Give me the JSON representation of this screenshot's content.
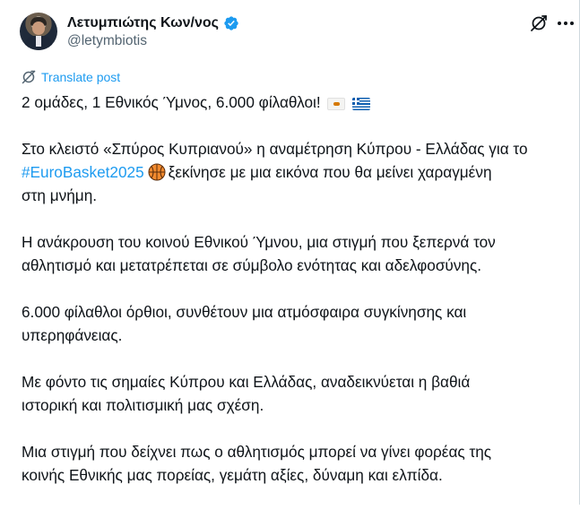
{
  "author": {
    "display_name": "Λετυμπιώτης Κων/νος",
    "handle": "@letymbiotis",
    "verified": true
  },
  "actions": {
    "grok_icon": "grok-icon",
    "more_icon": "more-icon"
  },
  "translate": {
    "label": "Translate post",
    "icon": "translate-icon"
  },
  "post": {
    "line1": "2 ομάδες, 1 Εθνικός Ύμνος, 6.000 φίλαθλοι!",
    "flags": [
      "cyprus-flag",
      "greece-flag"
    ],
    "p2_line1": "Στο κλειστό «Σπύρος Κυπριανού» η αναμέτρηση Κύπρου - Ελλάδας για το",
    "p2_hashtag": "#EuroBasket2025",
    "p2_after_hashtag": "ξεκίνησε με μια εικόνα που θα μείνει χαραγμένη",
    "p2_line3": "στη μνήμη.",
    "p3_line1": "Η ανάκρουση του κοινού Εθνικού Ύμνου, μια στιγμή που ξεπερνά τον",
    "p3_line2": "αθλητισμό και μετατρέπεται σε σύμβολο ενότητας και αδελφοσύνης.",
    "p4_line1": "6.000 φίλαθλοι όρθιοι, συνθέτουν μια ατμόσφαιρα συγκίνησης και",
    "p4_line2": "υπερηφάνειας.",
    "p5_line1": "Με φόντο τις σημαίες Κύπρου και Ελλάδας, αναδεικνύεται η βαθιά",
    "p5_line2": "ιστορική και πολιτισμική μας σχέση.",
    "p6_line1": "Μια στιγμή που δείχνει πως ο αθλητισμός μπορεί να γίνει φορέας της",
    "p6_line2": "κοινής Εθνικής μας πορείας, γεμάτη αξίες, δύναμη και ελπίδα."
  },
  "colors": {
    "text": "#0f1419",
    "secondary": "#536471",
    "link": "#1d9bf0",
    "verified": "#1d9bf0"
  }
}
